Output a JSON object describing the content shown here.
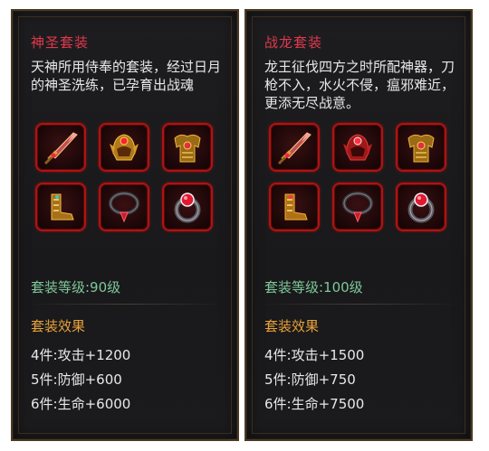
{
  "sets": [
    {
      "title": "神圣套装",
      "description": "天神所用侍奉的套装，经过日月的神圣洗练，已孕育出战魂",
      "items": [
        {
          "icon": "sword-icon"
        },
        {
          "icon": "helmet-icon"
        },
        {
          "icon": "armor-icon"
        },
        {
          "icon": "boots-icon"
        },
        {
          "icon": "necklace-icon"
        },
        {
          "icon": "ring-icon"
        }
      ],
      "level_text": "套装等级:90级",
      "effect_title": "套装效果",
      "effects": [
        "4件:攻击+1200",
        "5件:防御+600",
        "6件:生命+6000"
      ]
    },
    {
      "title": "战龙套装",
      "description": "龙王征伐四方之时所配神器，刀枪不入，水火不侵，瘟邪难近，更添无尽战意。",
      "items": [
        {
          "icon": "sword-icon"
        },
        {
          "icon": "helmet-icon"
        },
        {
          "icon": "armor-icon"
        },
        {
          "icon": "boots-icon"
        },
        {
          "icon": "necklace-icon"
        },
        {
          "icon": "ring-icon"
        }
      ],
      "level_text": "套装等级:100级",
      "effect_title": "套装效果",
      "effects": [
        "4件:攻击+1500",
        "5件:防御+750",
        "6件:生命+7500"
      ]
    }
  ],
  "colors": {
    "title": "#e0394a",
    "level": "#7fc79a",
    "effect_title": "#e8a23a",
    "slot_border": "#b01212"
  }
}
